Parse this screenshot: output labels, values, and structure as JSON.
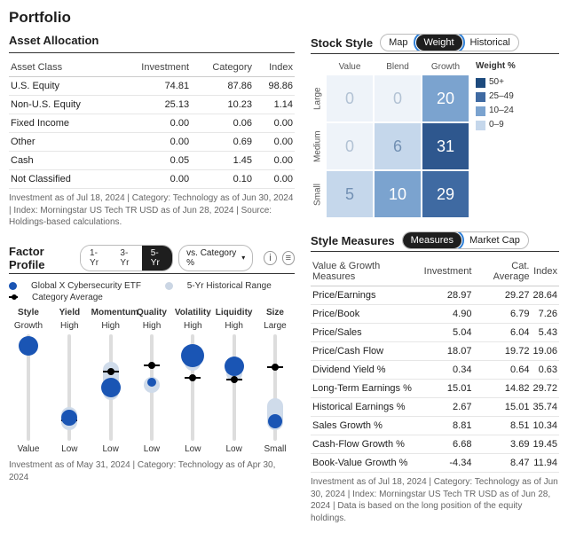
{
  "title": "Portfolio",
  "asset": {
    "heading": "Asset Allocation",
    "cols": [
      "Asset Class",
      "Investment",
      "Category",
      "Index"
    ],
    "rows": [
      {
        "c": "U.S. Equity",
        "i": "74.81",
        "g": "87.86",
        "x": "98.86"
      },
      {
        "c": "Non-U.S. Equity",
        "i": "25.13",
        "g": "10.23",
        "x": "1.14"
      },
      {
        "c": "Fixed Income",
        "i": "0.00",
        "g": "0.06",
        "x": "0.00"
      },
      {
        "c": "Other",
        "i": "0.00",
        "g": "0.69",
        "x": "0.00"
      },
      {
        "c": "Cash",
        "i": "0.05",
        "g": "1.45",
        "x": "0.00"
      },
      {
        "c": "Not Classified",
        "i": "0.00",
        "g": "0.10",
        "x": "0.00"
      }
    ],
    "footnote": "Investment as of Jul 18, 2024 | Category: Technology as of Jun 30, 2024 | Index: Morningstar US Tech TR USD as of Jun 28, 2024 | Source: Holdings-based calculations."
  },
  "stockstyle": {
    "heading": "Stock Style",
    "tabs": [
      "Map",
      "Weight",
      "Historical"
    ],
    "selected": "Weight",
    "cols": [
      "Value",
      "Blend",
      "Growth"
    ],
    "rows": [
      "Large",
      "Medium",
      "Small"
    ],
    "grid": [
      [
        0,
        0,
        20
      ],
      [
        0,
        6,
        31
      ],
      [
        5,
        10,
        29
      ]
    ],
    "legend_title": "Weight %",
    "legend": [
      {
        "label": "50+",
        "color": "#1d4a7d"
      },
      {
        "label": "25–49",
        "color": "#3f6aa2"
      },
      {
        "label": "10–24",
        "color": "#7ba3cf"
      },
      {
        "label": "0–9",
        "color": "#c5d7eb"
      }
    ]
  },
  "factor": {
    "heading": "Factor Profile",
    "periods": [
      "1-Yr",
      "3-Yr",
      "5-Yr"
    ],
    "selected": "5-Yr",
    "dropdown": "vs. Category %",
    "legend": [
      "Global X Cybersecurity ETF",
      "5-Yr Historical Range",
      "Category Average"
    ],
    "headers": [
      "Style",
      "Yield",
      "Momentum",
      "Quality",
      "Volatility",
      "Liquidity",
      "Size"
    ],
    "footnote": "Investment as of May 31, 2024 | Category: Technology as of Apr 30, 2024",
    "columns": [
      {
        "top": "Growth",
        "bot": "Value",
        "dot": 11,
        "dotSize": 22,
        "band": [
          6,
          18
        ],
        "cat": 12
      },
      {
        "top": "High",
        "bot": "Low",
        "dot": 78,
        "dotSize": 18,
        "band": [
          68,
          90
        ],
        "cat": 80
      },
      {
        "top": "High",
        "bot": "Low",
        "dot": 50,
        "dotSize": 22,
        "band": [
          26,
          62
        ],
        "cat": 34
      },
      {
        "top": "High",
        "bot": "Low",
        "dot": 45,
        "dotSize": 10,
        "band": [
          40,
          55
        ],
        "cat": 28
      },
      {
        "top": "High",
        "bot": "Low",
        "dot": 20,
        "dotSize": 26,
        "band": [
          10,
          34
        ],
        "cat": 40
      },
      {
        "top": "High",
        "bot": "Low",
        "dot": 30,
        "dotSize": 22,
        "band": [
          22,
          44
        ],
        "cat": 42
      },
      {
        "top": "Large",
        "bot": "Small",
        "dot": 82,
        "dotSize": 16,
        "band": [
          60,
          90
        ],
        "cat": 30
      }
    ]
  },
  "measures": {
    "heading": "Style Measures",
    "tabs": [
      "Measures",
      "Market Cap"
    ],
    "selected": "Measures",
    "cols": [
      "Value & Growth Measures",
      "Investment",
      "Cat. Average",
      "Index"
    ],
    "rows": [
      {
        "c": "Price/Earnings",
        "i": "28.97",
        "g": "29.27",
        "x": "28.64"
      },
      {
        "c": "Price/Book",
        "i": "4.90",
        "g": "6.79",
        "x": "7.26"
      },
      {
        "c": "Price/Sales",
        "i": "5.04",
        "g": "6.04",
        "x": "5.43"
      },
      {
        "c": "Price/Cash Flow",
        "i": "18.07",
        "g": "19.72",
        "x": "19.06"
      },
      {
        "c": "Dividend Yield %",
        "i": "0.34",
        "g": "0.64",
        "x": "0.63"
      },
      {
        "c": "Long-Term Earnings %",
        "i": "15.01",
        "g": "14.82",
        "x": "29.72"
      },
      {
        "c": "Historical Earnings %",
        "i": "2.67",
        "g": "15.01",
        "x": "35.74"
      },
      {
        "c": "Sales Growth %",
        "i": "8.81",
        "g": "8.51",
        "x": "10.34"
      },
      {
        "c": "Cash-Flow Growth %",
        "i": "6.68",
        "g": "3.69",
        "x": "19.45"
      },
      {
        "c": "Book-Value Growth %",
        "i": "-4.34",
        "g": "8.47",
        "x": "11.94"
      }
    ],
    "footnote": "Investment as of Jul 18, 2024 | Category: Technology as of Jun 30, 2024 | Index: Morningstar US Tech TR USD as of Jun 28, 2024 | Data is based on the long position of the equity holdings."
  }
}
